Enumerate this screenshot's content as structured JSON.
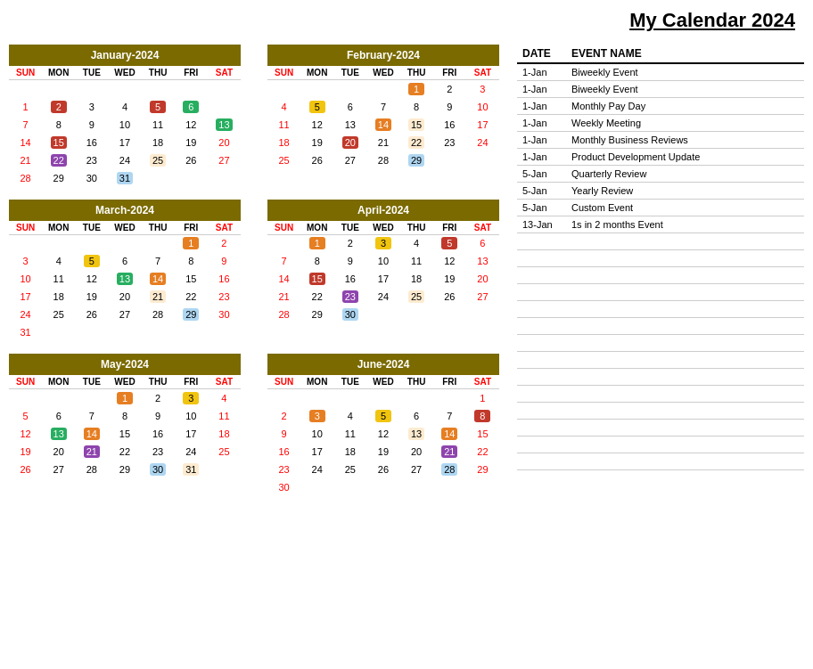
{
  "title": "My Calendar 2024",
  "months": [
    {
      "name": "January-2024",
      "weeks": [
        [
          null,
          null,
          null,
          null,
          null,
          null,
          null
        ],
        [
          "1",
          "2",
          "3",
          "4",
          "5",
          "6",
          null
        ],
        [
          "7",
          "8",
          "9",
          "10",
          "11",
          "12",
          "13"
        ],
        [
          "14",
          "15",
          "16",
          "17",
          "18",
          "19",
          "20"
        ],
        [
          "21",
          "22",
          "23",
          "24",
          "25",
          "26",
          "27"
        ],
        [
          "28",
          "29",
          "30",
          "31",
          null,
          null,
          null
        ]
      ],
      "highlights": {
        "2": "red",
        "5": "red",
        "6": "green",
        "13": "green",
        "15": "red",
        "22": "purple",
        "25": "lightyellow",
        "31": "lightblue"
      }
    },
    {
      "name": "February-2024",
      "weeks": [
        [
          null,
          null,
          null,
          null,
          "1",
          "2",
          "3"
        ],
        [
          "4",
          "5",
          "6",
          "7",
          "8",
          "9",
          "10"
        ],
        [
          "11",
          "12",
          "13",
          "14",
          "15",
          "16",
          "17"
        ],
        [
          "18",
          "19",
          "20",
          "21",
          "22",
          "23",
          "24"
        ],
        [
          "25",
          "26",
          "27",
          "28",
          "29",
          null,
          null
        ]
      ],
      "highlights": {
        "1": "orange",
        "5": "yellow",
        "14": "orange",
        "15": "lightyellow",
        "20": "red",
        "22": "lightyellow",
        "29": "lightblue"
      }
    },
    {
      "name": "March-2024",
      "weeks": [
        [
          null,
          null,
          null,
          null,
          null,
          "1",
          "2"
        ],
        [
          "3",
          "4",
          "5",
          "6",
          "7",
          "8",
          "9"
        ],
        [
          "10",
          "11",
          "12",
          "13",
          "14",
          "15",
          "16"
        ],
        [
          "17",
          "18",
          "19",
          "20",
          "21",
          "22",
          "23"
        ],
        [
          "24",
          "25",
          "26",
          "27",
          "28",
          "29",
          "30"
        ],
        [
          "31",
          null,
          null,
          null,
          null,
          null,
          null
        ]
      ],
      "highlights": {
        "1": "orange",
        "5": "yellow",
        "13": "green",
        "14": "orange",
        "21": "lightyellow",
        "29": "lightblue"
      }
    },
    {
      "name": "April-2024",
      "weeks": [
        [
          null,
          "1",
          "2",
          "3",
          "4",
          "5",
          "6"
        ],
        [
          "7",
          "8",
          "9",
          "10",
          "11",
          "12",
          "13"
        ],
        [
          "14",
          "15",
          "16",
          "17",
          "18",
          "19",
          "20"
        ],
        [
          "21",
          "22",
          "23",
          "24",
          "25",
          "26",
          "27"
        ],
        [
          "28",
          "29",
          "30",
          null,
          null,
          null,
          null
        ]
      ],
      "highlights": {
        "1": "orange",
        "3": "yellow",
        "5": "red",
        "15": "red",
        "23": "purple",
        "25": "lightyellow",
        "30": "lightblue"
      }
    },
    {
      "name": "May-2024",
      "weeks": [
        [
          null,
          null,
          null,
          "1",
          "2",
          "3",
          "4"
        ],
        [
          "5",
          "6",
          "7",
          "8",
          "9",
          "10",
          "11"
        ],
        [
          "12",
          "13",
          "14",
          "15",
          "16",
          "17",
          "18"
        ],
        [
          "19",
          "20",
          "21",
          "22",
          "23",
          "24",
          "25"
        ],
        [
          "26",
          "27",
          "28",
          "29",
          "30",
          "31",
          null
        ]
      ],
      "highlights": {
        "1": "orange",
        "3": "yellow",
        "13": "green",
        "14": "orange",
        "21": "purple",
        "30": "lightblue",
        "31": "lightyellow"
      }
    },
    {
      "name": "June-2024",
      "weeks": [
        [
          null,
          null,
          null,
          null,
          null,
          null,
          "1"
        ],
        [
          "2",
          "3",
          "4",
          "5",
          "6",
          "7",
          "8"
        ],
        [
          "9",
          "10",
          "11",
          "12",
          "13",
          "14",
          "15"
        ],
        [
          "16",
          "17",
          "18",
          "19",
          "20",
          "21",
          "22"
        ],
        [
          "23",
          "24",
          "25",
          "26",
          "27",
          "28",
          "29"
        ],
        [
          "30",
          null,
          null,
          null,
          null,
          null,
          null
        ]
      ],
      "highlights": {
        "3": "orange",
        "5": "yellow",
        "8": "red",
        "13": "lightyellow",
        "14": "orange",
        "21": "purple",
        "28": "lightblue"
      }
    }
  ],
  "events_header": {
    "date_col": "DATE",
    "name_col": "EVENT NAME"
  },
  "events": [
    {
      "date": "1-Jan",
      "name": "Biweekly Event"
    },
    {
      "date": "1-Jan",
      "name": "Biweekly Event"
    },
    {
      "date": "1-Jan",
      "name": "Monthly Pay Day"
    },
    {
      "date": "1-Jan",
      "name": "Weekly Meeting"
    },
    {
      "date": "1-Jan",
      "name": "Monthly Business Reviews"
    },
    {
      "date": "1-Jan",
      "name": "Product Development Update"
    },
    {
      "date": "5-Jan",
      "name": "Quarterly Review"
    },
    {
      "date": "5-Jan",
      "name": "Yearly Review"
    },
    {
      "date": "5-Jan",
      "name": "Custom Event"
    },
    {
      "date": "13-Jan",
      "name": "1s in 2 months Event"
    }
  ],
  "empty_rows": 14,
  "days": [
    "SUN",
    "MON",
    "TUE",
    "WED",
    "THU",
    "FRI",
    "SAT"
  ]
}
